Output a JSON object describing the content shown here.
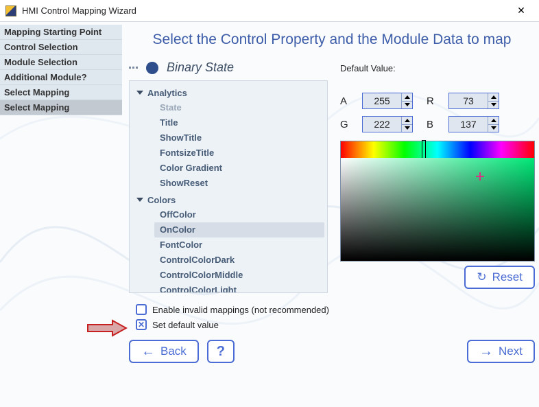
{
  "window": {
    "title": "HMI Control Mapping Wizard",
    "close_glyph": "✕"
  },
  "steps": [
    {
      "label": "Mapping Starting Point",
      "active": false
    },
    {
      "label": "Control Selection",
      "active": false
    },
    {
      "label": "Module Selection",
      "active": false
    },
    {
      "label": "Additional Module?",
      "active": false
    },
    {
      "label": "Select Mapping",
      "active": false
    },
    {
      "label": "Select Mapping",
      "active": true
    }
  ],
  "heading": "Select the Control Property and the Module Data to map",
  "control": {
    "name": "Binary State"
  },
  "tree": [
    {
      "group": "Analytics",
      "items": [
        {
          "label": "State",
          "dim": true
        },
        {
          "label": "Title"
        },
        {
          "label": "ShowTitle"
        },
        {
          "label": "FontsizeTitle"
        },
        {
          "label": "Color Gradient"
        },
        {
          "label": "ShowReset"
        }
      ]
    },
    {
      "group": "Colors",
      "items": [
        {
          "label": "OffColor"
        },
        {
          "label": "OnColor",
          "selected": true
        },
        {
          "label": "FontColor"
        },
        {
          "label": "ControlColorDark"
        },
        {
          "label": "ControlColorMiddle"
        },
        {
          "label": "ControlColorLight"
        }
      ]
    }
  ],
  "default_value": {
    "label": "Default Value:",
    "A": "255",
    "R": "73",
    "G": "222",
    "B": "137",
    "A_label": "A",
    "R_label": "R",
    "G_label": "G",
    "B_label": "B"
  },
  "checks": {
    "enable_invalid": {
      "label": "Enable invalid mappings (not recommended)",
      "checked": false
    },
    "set_default": {
      "label": "Set default value",
      "checked": true
    }
  },
  "buttons": {
    "reset": "Reset",
    "back": "Back",
    "help": "?",
    "next": "Next"
  }
}
